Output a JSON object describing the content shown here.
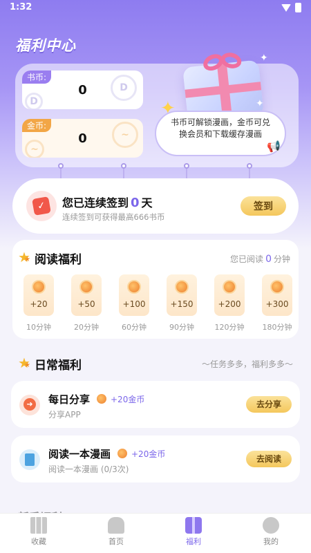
{
  "status": {
    "time": "1:32"
  },
  "page_title": "福利中心",
  "wallet": {
    "book_label": "书币:",
    "book_value": "0",
    "gold_label": "金币:",
    "gold_value": "0",
    "tip": "书币可解锁漫画，金币可兑换会员和下载缓存漫画"
  },
  "checkin": {
    "prefix": "您已连续签到",
    "days": "0",
    "suffix": "天",
    "subtitle": "连续签到可获得最高666书币",
    "button": "签到"
  },
  "reading": {
    "title": "阅读福利",
    "meta_prefix": "您已阅读",
    "minutes": "0",
    "meta_suffix": "分钟",
    "rewards": [
      {
        "amount": "+20",
        "time": "10分钟"
      },
      {
        "amount": "+50",
        "time": "20分钟"
      },
      {
        "amount": "+100",
        "time": "60分钟"
      },
      {
        "amount": "+150",
        "time": "90分钟"
      },
      {
        "amount": "+200",
        "time": "120分钟"
      },
      {
        "amount": "+300",
        "time": "180分钟"
      }
    ]
  },
  "daily": {
    "title": "日常福利",
    "slogan": "～任务多多，福利多多～",
    "tasks": [
      {
        "name": "每日分享",
        "reward": "+20金币",
        "desc": "分享APP",
        "button": "去分享"
      },
      {
        "name": "阅读一本漫画",
        "reward": "+20金币",
        "desc": "阅读一本漫画 (0/3次)",
        "button": "去阅读"
      }
    ]
  },
  "newbie": {
    "title": "新手福利"
  },
  "tabbar": [
    {
      "label": "收藏",
      "icon": "bookshelf-icon"
    },
    {
      "label": "首页",
      "icon": "home-icon"
    },
    {
      "label": "福利",
      "icon": "gift-icon"
    },
    {
      "label": "我的",
      "icon": "profile-icon"
    }
  ],
  "colors": {
    "accent": "#7b66ea",
    "gold_button": "#f4c75c",
    "hero_top": "#8e7cf0"
  }
}
